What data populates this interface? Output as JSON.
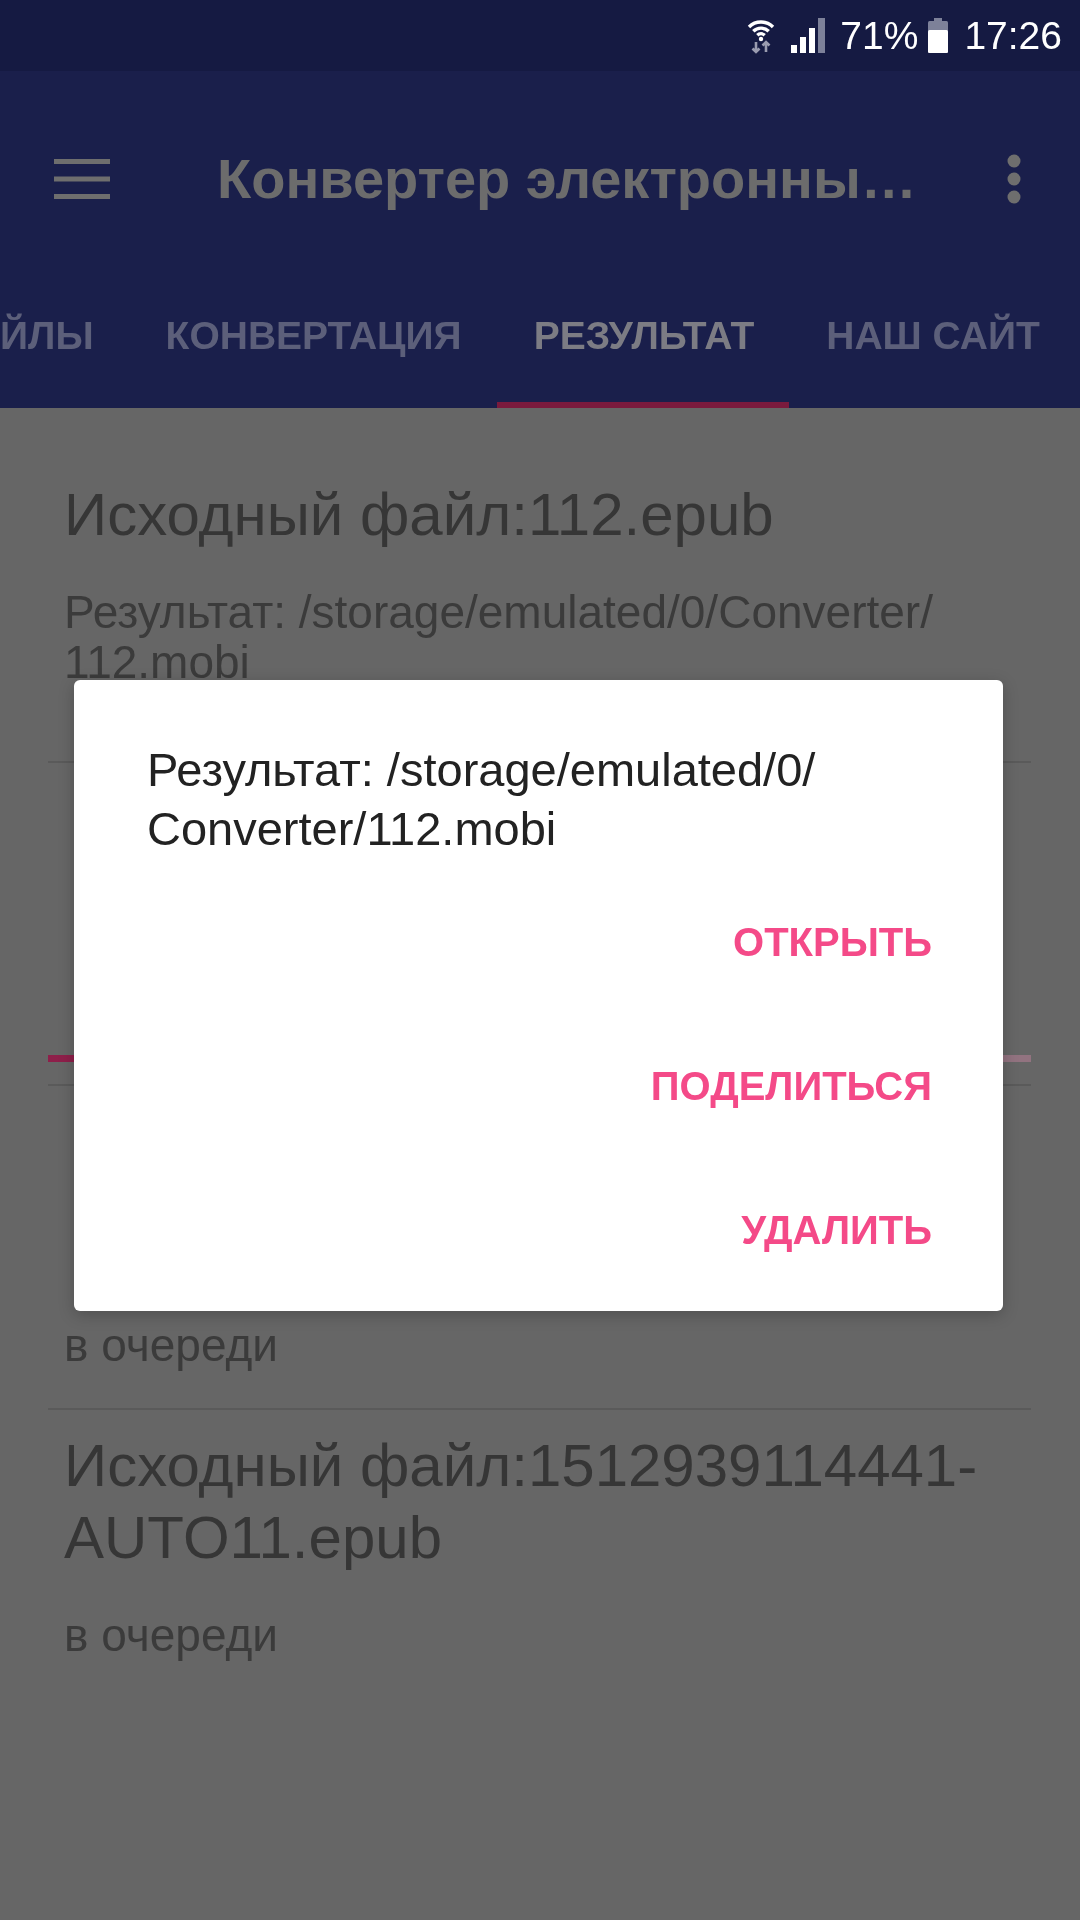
{
  "status_bar": {
    "battery": "71%",
    "time": "17:26"
  },
  "toolbar": {
    "title": "Конвертер электронны…"
  },
  "tabs": [
    {
      "label": "ЙЛЫ",
      "selected": false
    },
    {
      "label": "КОНВЕРТАЦИЯ",
      "selected": false
    },
    {
      "label": "РЕЗУЛЬТАТ",
      "selected": true
    },
    {
      "label": "НАШ САЙТ",
      "selected": false
    }
  ],
  "results": [
    {
      "kind": "done",
      "title": "Исходный файл:112.epub",
      "subtitle": "Результат: /storage/emulated/0/Converter/112.mobi"
    },
    {
      "kind": "converting",
      "level": 0.5
    },
    {
      "kind": "queued",
      "subtitle": "в очереди"
    },
    {
      "kind": "queued",
      "title": "Исходный файл:1512939114441-AUTO11.epub",
      "subtitle": "в очереди"
    }
  ],
  "dialog": {
    "message": "Результат: /storage/emulated/0/Converter/112.mobi",
    "buttons": [
      "ОТКРЫТЬ",
      "ПОДЕЛИТЬСЯ",
      "УДАЛИТЬ"
    ]
  }
}
